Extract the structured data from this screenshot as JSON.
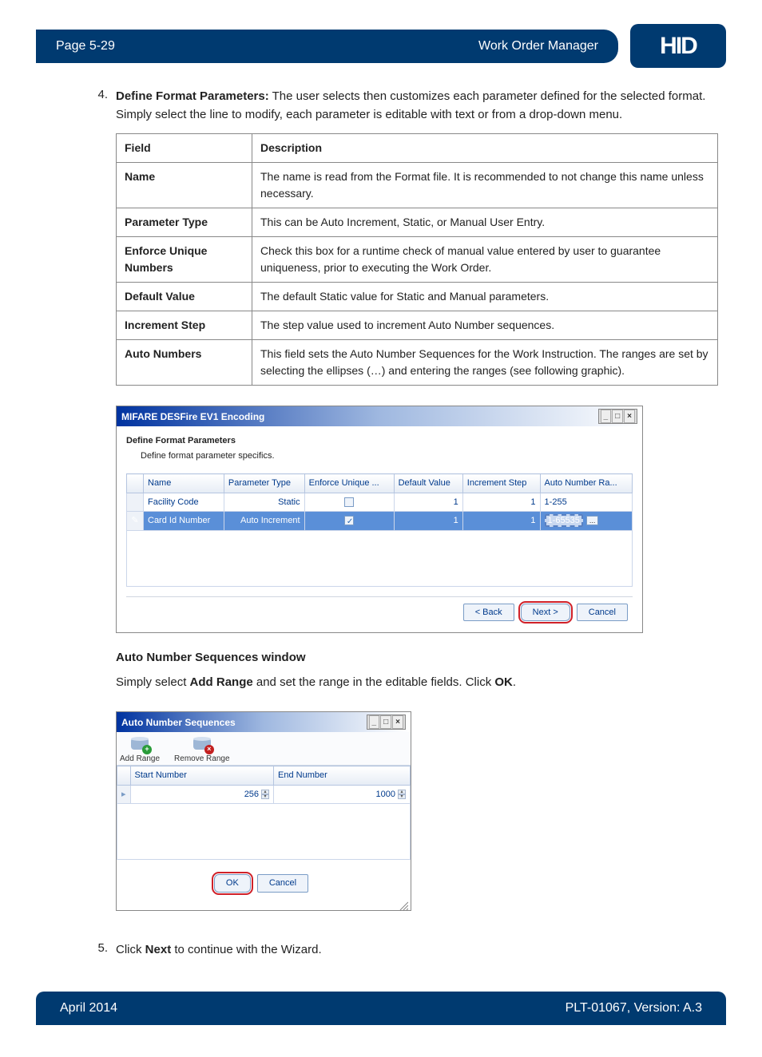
{
  "header": {
    "page": "Page 5-29",
    "title": "Work Order Manager",
    "logo": "HID"
  },
  "step4": {
    "num": "4.",
    "lead": "Define Format Parameters:",
    "text": " The user selects then customizes each parameter defined for the selected format. Simply select the line to modify, each parameter is editable with text or from a drop-down menu."
  },
  "table": {
    "h_field": "Field",
    "h_desc": "Description",
    "rows": [
      {
        "f": "Name",
        "d": "The name is read from the Format file. It is recommended to not change this name unless necessary."
      },
      {
        "f": "Parameter Type",
        "d": "This can be Auto Increment, Static, or Manual User Entry."
      },
      {
        "f": "Enforce Unique Numbers",
        "d": "Check this box for a runtime check of manual value entered by user to guarantee uniqueness, prior to executing the Work Order."
      },
      {
        "f": "Default Value",
        "d": "The default Static value for Static and Manual parameters."
      },
      {
        "f": "Increment Step",
        "d": "The step value used to increment Auto Number sequences."
      },
      {
        "f": "Auto Numbers",
        "d": "This field sets the Auto Number Sequences for the Work Instruction. The ranges are set by selecting the ellipses (…) and entering the ranges (see following graphic)."
      }
    ]
  },
  "win1": {
    "title": "MIFARE DESFire EV1 Encoding",
    "sub_title": "Define Format Parameters",
    "sub_desc": "Define format parameter specifics.",
    "cols": {
      "c0": "",
      "c1": "Name",
      "c2": "Parameter Type",
      "c3": "Enforce Unique ...",
      "c4": "Default Value",
      "c5": "Increment Step",
      "c6": "Auto Number Ra..."
    },
    "r1": {
      "name": "Facility Code",
      "ptype": "Static",
      "defv": "1",
      "istep": "1",
      "auto": "1-255"
    },
    "r2": {
      "name": "Card Id Number",
      "ptype": "Auto Increment",
      "defv": "1",
      "istep": "1",
      "auto": "1-65535"
    },
    "back": "< Back",
    "next": "Next >",
    "cancel": "Cancel",
    "ellipsis": "..."
  },
  "seq_heading": "Auto Number Sequences window",
  "seq_text_a": "Simply select ",
  "seq_add": "Add Range",
  "seq_text_b": " and set the range in the editable fields. Click ",
  "seq_ok": "OK",
  "seq_text_c": ".",
  "win2": {
    "title": "Auto Number Sequences",
    "add": "Add Range",
    "remove": "Remove Range",
    "col_start": "Start Number",
    "col_end": "End Number",
    "start_val": "256",
    "end_val": "1000",
    "ok": "OK",
    "cancel": "Cancel"
  },
  "step5": {
    "num": "5.",
    "a": "Click ",
    "b": "Next",
    "c": " to continue with the Wizard."
  },
  "footer": {
    "date": "April 2014",
    "doc": "PLT-01067, Version: A.3"
  }
}
